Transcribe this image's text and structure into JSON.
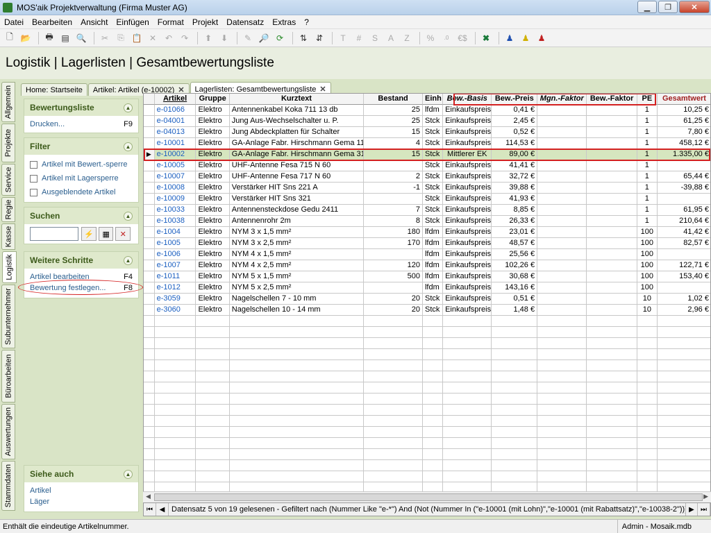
{
  "window": {
    "title": "MOS'aik Projektverwaltung (Firma Muster AG)"
  },
  "menu": [
    "Datei",
    "Bearbeiten",
    "Ansicht",
    "Einfügen",
    "Format",
    "Projekt",
    "Datensatz",
    "Extras",
    "?"
  ],
  "toolbar": {
    "icons": [
      "new-file-icon",
      "open-folder-icon",
      "print-icon",
      "print-preview-icon",
      "page-preview-icon",
      "cut-icon",
      "copy-icon",
      "paste-icon",
      "delete-icon",
      "undo-icon",
      "redo-icon",
      "arrow-up-icon",
      "arrow-down-icon",
      "edit-icon",
      "find-icon",
      "refresh-icon",
      "sort-asc-icon",
      "sort-desc-icon",
      "text-icon",
      "hash-icon",
      "sum-icon",
      "avg-icon",
      "z-icon",
      "percent-icon",
      "decimal-icon",
      "currency-icon",
      "excel-icon",
      "user-blue-icon",
      "user-yellow-icon",
      "user-red-icon"
    ],
    "labels": {
      "text": "T",
      "hash": "#",
      "s": "S",
      "a": "A",
      "z": "Z",
      "percent": "%",
      "currency": "€$"
    }
  },
  "header": {
    "title": "Logistik | Lagerlisten | Gesamtbewertungsliste"
  },
  "vtabs": [
    "Allgemein",
    "Projekte",
    "Service",
    "Regie",
    "Kasse",
    "Logistik",
    "Subunternehmer",
    "Büroarbeiten",
    "Auswertungen",
    "Stammdaten"
  ],
  "tabs": [
    {
      "label": "Home: Startseite"
    },
    {
      "label": "Artikel: Artikel (e-10002)"
    },
    {
      "label": "Lagerlisten: Gesamtbewertungsliste"
    }
  ],
  "sidebar": {
    "bewertungsliste": {
      "title": "Bewertungsliste",
      "items": [
        {
          "label": "Drucken...",
          "key": "F9"
        }
      ]
    },
    "filter": {
      "title": "Filter",
      "items": [
        "Artikel mit Bewert.-sperre",
        "Artikel mit Lagersperre",
        "Ausgeblendete Artikel"
      ]
    },
    "suchen": {
      "title": "Suchen"
    },
    "weitere": {
      "title": "Weitere Schritte",
      "items": [
        {
          "label": "Artikel bearbeiten",
          "key": "F4"
        },
        {
          "label": "Bewertung festlegen...",
          "key": "F8"
        }
      ]
    },
    "siehe": {
      "title": "Siehe auch",
      "items": [
        "Artikel",
        "Läger"
      ]
    }
  },
  "table": {
    "columns": [
      "Artikel",
      "Gruppe",
      "Kurztext",
      "Bestand",
      "Einh",
      "Bew.-Basis",
      "Bew.-Preis",
      "Mgn.-Faktor",
      "Bew.-Faktor",
      "PE",
      "Gesamtwert"
    ],
    "rows": [
      [
        "e-01066",
        "Elektro",
        "Antennenkabel Koka 711 13 db",
        "25",
        "lfdm",
        "Einkaufspreis",
        "0,41 €",
        "",
        "",
        "1",
        "10,25 €"
      ],
      [
        "e-04001",
        "Elektro",
        "Jung Aus-Wechselschalter u. P.",
        "25",
        "Stck",
        "Einkaufspreis",
        "2,45 €",
        "",
        "",
        "1",
        "61,25 €"
      ],
      [
        "e-04013",
        "Elektro",
        "Jung Abdeckplatten für Schalter",
        "15",
        "Stck",
        "Einkaufspreis",
        "0,52 €",
        "",
        "",
        "1",
        "7,80 €"
      ],
      [
        "e-10001",
        "Elektro",
        "GA-Anlage Fabr. Hirschmann Gema 11",
        "4",
        "Stck",
        "Einkaufspreis",
        "114,53 €",
        "",
        "",
        "1",
        "458,12 €"
      ],
      [
        "e-10002",
        "Elektro",
        "GA-Anlage Fabr. Hirschmann Gema 31",
        "15",
        "Stck",
        "Mittlerer EK",
        "89,00 €",
        "",
        "",
        "1",
        "1.335,00 €"
      ],
      [
        "e-10005",
        "Elektro",
        "UHF-Antenne Fesa 715 N 60",
        "",
        "Stck",
        "Einkaufspreis",
        "41,41 €",
        "",
        "",
        "1",
        ""
      ],
      [
        "e-10007",
        "Elektro",
        "UHF-Antenne Fesa 717 N 60",
        "2",
        "Stck",
        "Einkaufspreis",
        "32,72 €",
        "",
        "",
        "1",
        "65,44 €"
      ],
      [
        "e-10008",
        "Elektro",
        "Verstärker HIT Sns 221 A",
        "-1",
        "Stck",
        "Einkaufspreis",
        "39,88 €",
        "",
        "",
        "1",
        "-39,88 €"
      ],
      [
        "e-10009",
        "Elektro",
        "Verstärker HIT Sns 321",
        "",
        "Stck",
        "Einkaufspreis",
        "41,93 €",
        "",
        "",
        "1",
        ""
      ],
      [
        "e-10033",
        "Elektro",
        "Antennensteckdose Gedu 2411",
        "7",
        "Stck",
        "Einkaufspreis",
        "8,85 €",
        "",
        "",
        "1",
        "61,95 €"
      ],
      [
        "e-10038",
        "Elektro",
        "Antennenrohr 2m",
        "8",
        "Stck",
        "Einkaufspreis",
        "26,33 €",
        "",
        "",
        "1",
        "210,64 €"
      ],
      [
        "e-1004",
        "Elektro",
        "NYM 3 x 1,5 mm²",
        "180",
        "lfdm",
        "Einkaufspreis",
        "23,01 €",
        "",
        "",
        "100",
        "41,42 €"
      ],
      [
        "e-1005",
        "Elektro",
        "NYM 3 x 2,5 mm²",
        "170",
        "lfdm",
        "Einkaufspreis",
        "48,57 €",
        "",
        "",
        "100",
        "82,57 €"
      ],
      [
        "e-1006",
        "Elektro",
        "NYM 4 x 1,5 mm²",
        "",
        "lfdm",
        "Einkaufspreis",
        "25,56 €",
        "",
        "",
        "100",
        ""
      ],
      [
        "e-1007",
        "Elektro",
        "NYM 4 x 2,5 mm²",
        "120",
        "lfdm",
        "Einkaufspreis",
        "102,26 €",
        "",
        "",
        "100",
        "122,71 €"
      ],
      [
        "e-1011",
        "Elektro",
        "NYM 5 x 1,5 mm²",
        "500",
        "lfdm",
        "Einkaufspreis",
        "30,68 €",
        "",
        "",
        "100",
        "153,40 €"
      ],
      [
        "e-1012",
        "Elektro",
        "NYM 5 x 2,5 mm²",
        "",
        "lfdm",
        "Einkaufspreis",
        "143,16 €",
        "",
        "",
        "100",
        ""
      ],
      [
        "e-3059",
        "Elektro",
        "Nagelschellen 7 - 10 mm",
        "20",
        "Stck",
        "Einkaufspreis",
        "0,51 €",
        "",
        "",
        "10",
        "1,02 €"
      ],
      [
        "e-3060",
        "Elektro",
        "Nagelschellen 10 - 14 mm",
        "20",
        "Stck",
        "Einkaufspreis",
        "1,48 €",
        "",
        "",
        "10",
        "2,96 €"
      ]
    ],
    "selected_row": 4
  },
  "navbar": {
    "text": "Datensatz 5 von 19 gelesenen - Gefiltert nach (Nummer Like \"e-*\") And (Not (Nummer In (\"e-10001 (mit Lohn)\",\"e-10001 (mit Rabattsatz)\",\"e-10038-2\")))"
  },
  "status": {
    "left": "Enthält die eindeutige Artikelnummer.",
    "right": "Admin - Mosaik.mdb"
  }
}
